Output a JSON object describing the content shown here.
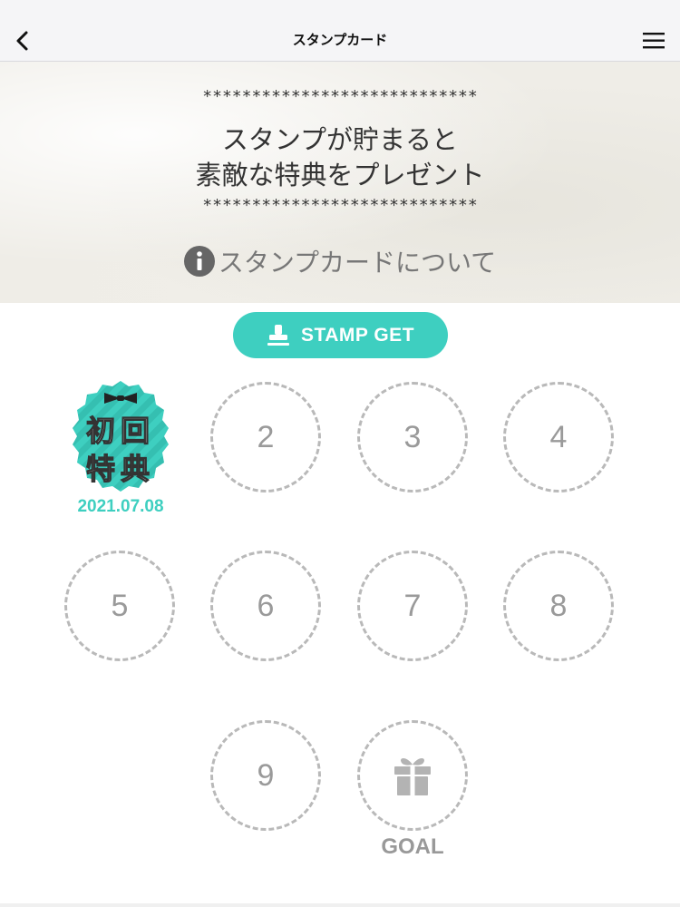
{
  "header": {
    "title": "スタンプカード",
    "back_icon": "chevron-left-icon",
    "menu_icon": "hamburger-menu-icon"
  },
  "hero": {
    "stars_top": "****************************",
    "message_line1": "スタンプが貯まると",
    "message_line2": "素敵な特典をプレゼント",
    "stars_bottom": "****************************",
    "info_link": "スタンプカードについて",
    "info_icon": "info-icon"
  },
  "stamp_button": {
    "label": "STAMP GET",
    "icon": "stamp-icon"
  },
  "stamps": {
    "first": {
      "line1": "初回",
      "line2": "特典",
      "date": "2021.07.08",
      "icon": "bow-tie-icon"
    },
    "slots": [
      "2",
      "3",
      "4",
      "5",
      "6",
      "7",
      "8",
      "9"
    ],
    "goal": {
      "label": "GOAL",
      "icon": "gift-icon"
    }
  },
  "colors": {
    "accent": "#3ecfc0",
    "slot_border": "#b9b9b9",
    "slot_number": "#9a9a9a"
  }
}
